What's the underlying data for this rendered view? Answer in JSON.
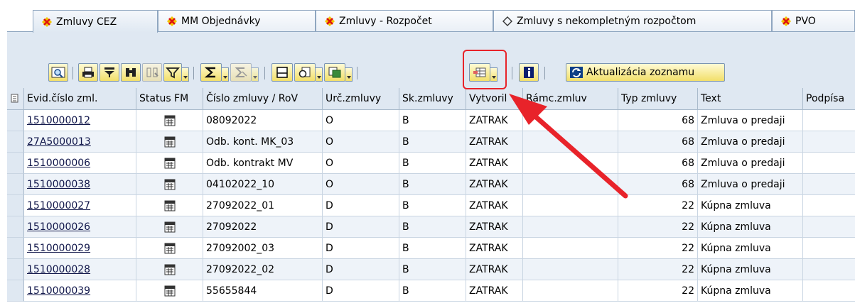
{
  "tabs": [
    {
      "label": "Zmluvy CEZ",
      "icon": "red-x-diamond-icon",
      "active": true
    },
    {
      "label": "MM Objednávky",
      "icon": "red-x-diamond-icon",
      "active": false
    },
    {
      "label": "Zmluvy - Rozpočet",
      "icon": "red-x-diamond-icon",
      "active": false
    },
    {
      "label": "Zmluvy s nekompletným rozpočtom",
      "icon": "outline-diamond-icon",
      "active": false
    },
    {
      "label": "PVO",
      "icon": "red-x-diamond-icon",
      "active": false
    }
  ],
  "toolbar": {
    "buttons": [
      {
        "name": "details-icon"
      },
      {
        "name": "print-icon"
      },
      {
        "name": "filter-set-icon"
      },
      {
        "name": "find-icon"
      },
      {
        "name": "find-next-icon"
      },
      {
        "name": "filter-icon"
      },
      {
        "name": "sum-icon"
      },
      {
        "name": "subtotal-icon"
      },
      {
        "name": "print-preview-icon"
      },
      {
        "name": "export-word-icon"
      },
      {
        "name": "export-icon"
      },
      {
        "name": "change-layout-icon"
      },
      {
        "name": "info-icon"
      }
    ],
    "refresh_label": "Aktualizácia zoznamu"
  },
  "table": {
    "columns": [
      "Evid.číslo zml.",
      "Status FM",
      "Číslo zmluvy / RoV",
      "Urč.zmluvy",
      "Sk.zmluvy",
      "Vytvoril",
      "Rámc.zmluv",
      "Typ zmluvy",
      "Text",
      "Podpísa"
    ],
    "rows": [
      {
        "evid": "1510000012",
        "cislo": "08092022",
        "urc": "O",
        "sk": "B",
        "vytvoril": "ZATRAK",
        "typ": "68",
        "text": "Zmluva o predaji"
      },
      {
        "evid": "27A5000013",
        "cislo": "Odb. kont. MK_03",
        "urc": "O",
        "sk": "B",
        "vytvoril": "ZATRAK",
        "typ": "68",
        "text": "Zmluva o predaji"
      },
      {
        "evid": "1510000006",
        "cislo": "Odb. kontrakt MV",
        "urc": "O",
        "sk": "B",
        "vytvoril": "ZATRAK",
        "typ": "68",
        "text": "Zmluva o predaji"
      },
      {
        "evid": "1510000038",
        "cislo": "04102022_10",
        "urc": "O",
        "sk": "B",
        "vytvoril": "ZATRAK",
        "typ": "68",
        "text": "Zmluva o predaji"
      },
      {
        "evid": "1510000027",
        "cislo": "27092022_01",
        "urc": "D",
        "sk": "B",
        "vytvoril": "ZATRAK",
        "typ": "22",
        "text": "Kúpna zmluva"
      },
      {
        "evid": "1510000026",
        "cislo": "27092022",
        "urc": "D",
        "sk": "B",
        "vytvoril": "ZATRAK",
        "typ": "22",
        "text": "Kúpna zmluva"
      },
      {
        "evid": "1510000029",
        "cislo": "27092002_03",
        "urc": "D",
        "sk": "B",
        "vytvoril": "ZATRAK",
        "typ": "22",
        "text": "Kúpna zmluva"
      },
      {
        "evid": "1510000028",
        "cislo": "27092022_02",
        "urc": "D",
        "sk": "B",
        "vytvoril": "ZATRAK",
        "typ": "22",
        "text": "Kúpna zmluva"
      },
      {
        "evid": "1510000039",
        "cislo": "55655844",
        "urc": "D",
        "sk": "B",
        "vytvoril": "ZATRAK",
        "typ": "22",
        "text": "Kúpna zmluva"
      }
    ]
  },
  "colors": {
    "annotation": "#e8232a",
    "panel": "#dfe8f2",
    "button": "#f2df6a"
  }
}
